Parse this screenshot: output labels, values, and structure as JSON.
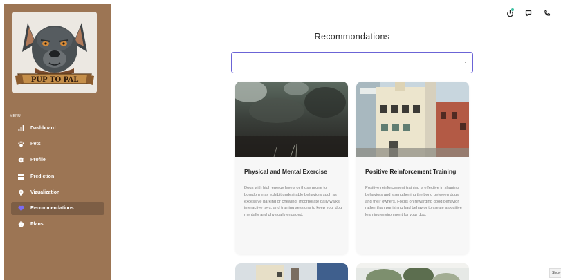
{
  "sidebar": {
    "logo_text": "PUP TO PAL",
    "menu_label": "MENU",
    "items": [
      {
        "label": "Dashboard",
        "icon": "bar-chart-icon"
      },
      {
        "label": "Pets",
        "icon": "paw-icon"
      },
      {
        "label": "Profile",
        "icon": "gear-icon"
      },
      {
        "label": "Prediction",
        "icon": "grid-icon"
      },
      {
        "label": "Vizualization",
        "icon": "bulb-icon"
      },
      {
        "label": "Recommendations",
        "icon": "heart-icon",
        "active": true
      },
      {
        "label": "Plans",
        "icon": "clock-icon"
      }
    ]
  },
  "topbar": {
    "icons": [
      "power-icon",
      "chat-icon",
      "phone-icon"
    ],
    "status_color": "#3cc1a2"
  },
  "main": {
    "title": "Recommondations",
    "select_value": "",
    "cards": [
      {
        "title": "Physical and Mental Exercise",
        "description": "Dogs with high energy levels or those prone to boredom may exhibit undesirable behaviors such as excessive barking or chewing. Incorporate daily walks, interactive toys, and training sessions to keep your dog mentally and physically engaged."
      },
      {
        "title": "Positive Reinforcement Training",
        "description": "Positive reinforcement training is effective in shaping behaviors and strengthening the bond between dogs and their owners. Focus on rewarding good behavior rather than punishing bad behavior to create a positive learning environment for your dog."
      }
    ]
  },
  "show_tab": "Show",
  "colors": {
    "sidebar": "#9c7554",
    "active_item": "#7d5e45",
    "select_border": "#6b64d6",
    "card_bg": "#f7f7f7"
  }
}
